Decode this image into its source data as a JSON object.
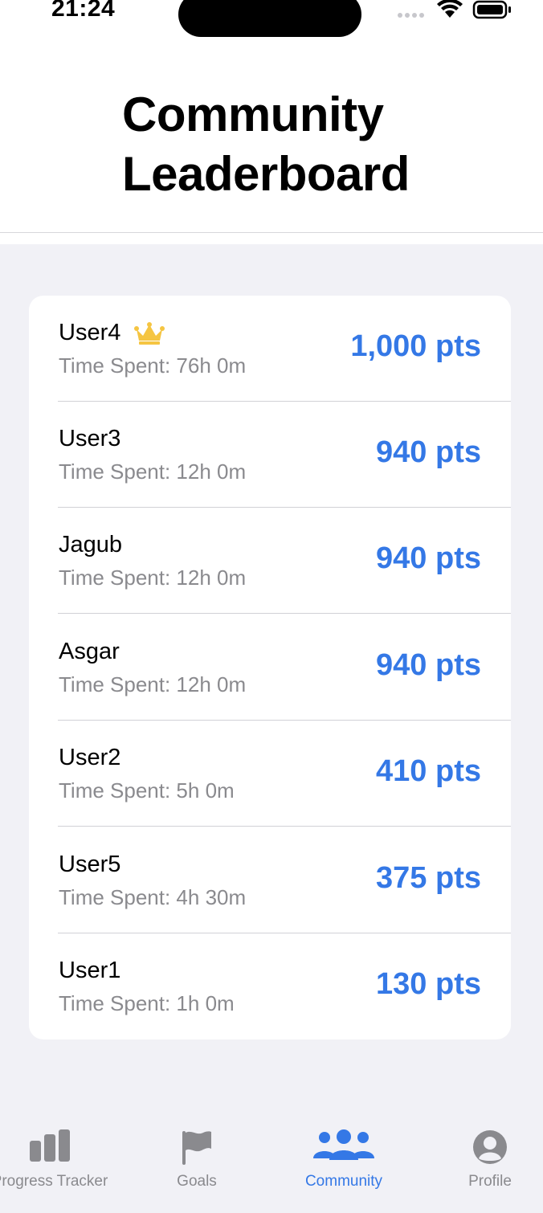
{
  "status_bar": {
    "time": "21:24"
  },
  "header": {
    "title": "Community Leaderboard"
  },
  "leaderboard": {
    "entries": [
      {
        "name": "User4",
        "time_spent": "Time Spent: 76h 0m",
        "points": "1,000 pts",
        "crown": true
      },
      {
        "name": "User3",
        "time_spent": "Time Spent: 12h 0m",
        "points": "940 pts"
      },
      {
        "name": "Jagub",
        "time_spent": "Time Spent: 12h 0m",
        "points": "940 pts"
      },
      {
        "name": "Asgar",
        "time_spent": "Time Spent: 12h 0m",
        "points": "940 pts"
      },
      {
        "name": "User2",
        "time_spent": "Time Spent: 5h 0m",
        "points": "410 pts"
      },
      {
        "name": "User5",
        "time_spent": "Time Spent: 4h 30m",
        "points": "375 pts"
      },
      {
        "name": "User1",
        "time_spent": "Time Spent: 1h 0m",
        "points": "130 pts"
      }
    ]
  },
  "tab_bar": {
    "tabs": [
      {
        "label": "Progress Tracker",
        "icon": "bar-chart-icon",
        "active": false
      },
      {
        "label": "Goals",
        "icon": "flag-icon",
        "active": false
      },
      {
        "label": "Community",
        "icon": "people-icon",
        "active": true
      },
      {
        "label": "Profile",
        "icon": "person-circle-icon",
        "active": false
      }
    ]
  },
  "colors": {
    "accent": "#3478e6",
    "crown": "#f5c542",
    "secondary_text": "#8a8a8e",
    "background": "#f1f1f6"
  }
}
